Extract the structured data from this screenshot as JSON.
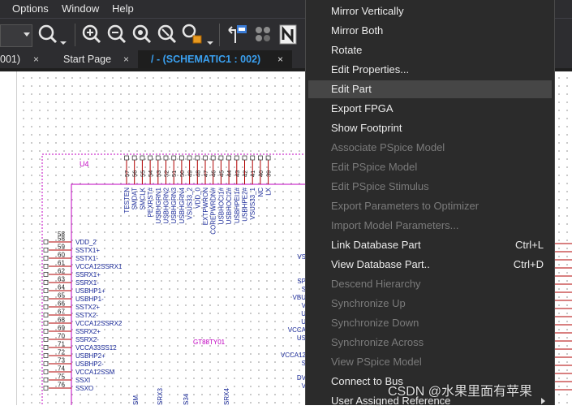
{
  "menubar": {
    "items": [
      "Options",
      "Window",
      "Help"
    ]
  },
  "tabs": [
    {
      "label": "001)",
      "close": "×"
    },
    {
      "label": "Start Page",
      "close": "×"
    },
    {
      "label": "/ - (SCHEMATIC1 : 002)",
      "close": "×"
    }
  ],
  "schematic": {
    "ref": "U4",
    "part_value": "GT88TY01",
    "top_numbers": [
      "57",
      "56",
      "55",
      "54",
      "53",
      "52",
      "51",
      "50",
      "49",
      "48",
      "47",
      "46",
      "45",
      "44",
      "43",
      "42",
      "41",
      "40",
      "39"
    ],
    "top_pins": [
      "TESTEN",
      "SMDAT",
      "SMCLK",
      "PEXRST#",
      "USBHGRN1",
      "USBHGRN2",
      "USBHGRN3",
      "USBHGRN4",
      "VSUS33_2",
      "VDD_0",
      "EXTPWRON",
      "COREPWRDN#",
      "USBHOCI1#",
      "USBHOCI2#",
      "USBHPEI1#",
      "USBHPE2#",
      "VSUS33_1",
      "NC",
      "LX"
    ],
    "left_numbers": [
      "58",
      "59",
      "60",
      "61",
      "62",
      "63",
      "64",
      "65",
      "66",
      "67",
      "68",
      "69",
      "70",
      "71",
      "72",
      "73",
      "74",
      "75",
      "76"
    ],
    "left_pins": [
      "VDD_2",
      "SSTX1+",
      "SSTX1-",
      "VCCA12SSRX1",
      "SSRX1+",
      "SSRX1-",
      "USBHP1+",
      "USBHP1-",
      "SSTX2+",
      "SSTX2-",
      "VCCA12SSRX2",
      "SSRX2+",
      "SSRX2-",
      "VCCA33SS12",
      "USBHP2+",
      "USBHP2-",
      "VCCA12SSM",
      "SSXI",
      "SSXO"
    ],
    "right_pins": [
      "VS",
      "SP",
      "S",
      "VBU",
      "V",
      "U",
      "U",
      "VCCA",
      "US",
      "VCCA12",
      "S",
      "DV",
      "V"
    ],
    "bottom_pins": [
      "SM",
      "SRX3",
      "S34",
      "SRX4"
    ]
  },
  "context_menu": {
    "items": [
      {
        "label": "Mirror Vertically",
        "shortcut": "",
        "enabled": true
      },
      {
        "label": "Mirror Both",
        "shortcut": "",
        "enabled": true
      },
      {
        "label": "Rotate",
        "shortcut": "",
        "enabled": true
      },
      {
        "label": "Edit Properties...",
        "shortcut": "",
        "enabled": true
      },
      {
        "label": "Edit Part",
        "shortcut": "",
        "enabled": true,
        "highlighted": true
      },
      {
        "label": "Export FPGA",
        "shortcut": "",
        "enabled": true
      },
      {
        "label": "Show Footprint",
        "shortcut": "",
        "enabled": true
      },
      {
        "label": "Associate PSpice Model",
        "shortcut": "",
        "enabled": false
      },
      {
        "label": "Edit PSpice Model",
        "shortcut": "",
        "enabled": false
      },
      {
        "label": "Edit PSpice Stimulus",
        "shortcut": "",
        "enabled": false
      },
      {
        "label": "Export Parameters to Optimizer",
        "shortcut": "",
        "enabled": false
      },
      {
        "label": "Import Model Parameters...",
        "shortcut": "",
        "enabled": false
      },
      {
        "label": "Link Database Part",
        "shortcut": "Ctrl+L",
        "enabled": true
      },
      {
        "label": "View Database Part..",
        "shortcut": "Ctrl+D",
        "enabled": true
      },
      {
        "label": "Descend Hierarchy",
        "shortcut": "",
        "enabled": false
      },
      {
        "label": "Synchronize Up",
        "shortcut": "",
        "enabled": false
      },
      {
        "label": "Synchronize Down",
        "shortcut": "",
        "enabled": false
      },
      {
        "label": "Synchronize Across",
        "shortcut": "",
        "enabled": false
      },
      {
        "label": "View PSpice Model",
        "shortcut": "",
        "enabled": false
      },
      {
        "label": "Connect to Bus",
        "shortcut": "",
        "enabled": true
      },
      {
        "label": "User Assigned Reference",
        "shortcut": "",
        "enabled": true,
        "submenu": true
      }
    ]
  },
  "watermark": "CSDN @水果里面有苹果",
  "colors": {
    "chrome_bg": "#2d2d30",
    "active_tab_text": "#3aa0f0",
    "part_outline": "#c000c0",
    "pin_line": "#b00000",
    "pin_text": "#1a2a99",
    "menu_bg": "#2b2b2b",
    "menu_highlight": "#464646"
  },
  "icons": [
    "zoom-icon",
    "zoom-in-icon",
    "zoom-out-icon",
    "zoom-fit-icon",
    "zoom-area-icon",
    "search-part-icon",
    "net-number-icon",
    "rotate-part-icon",
    "new-page-icon"
  ]
}
